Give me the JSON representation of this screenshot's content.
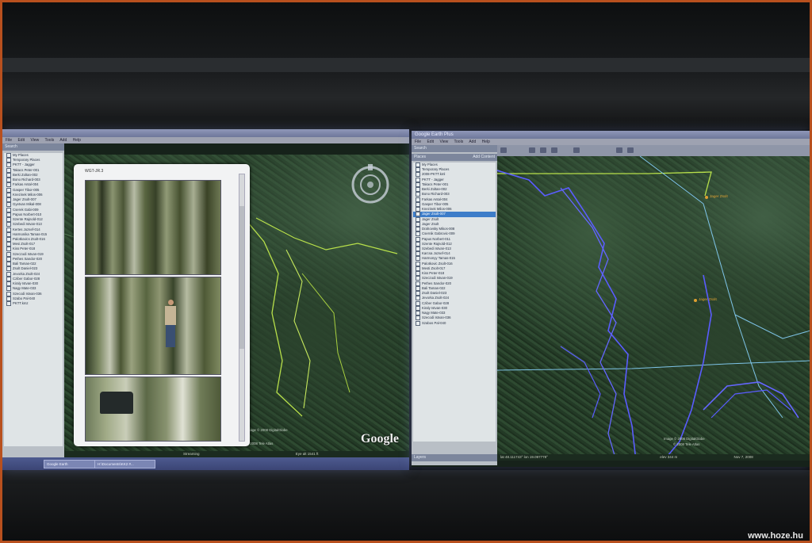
{
  "left_window": {
    "menu": [
      "File",
      "Edit",
      "View",
      "Tools",
      "Add",
      "Help"
    ],
    "search_label": "Search",
    "tree_items": [
      "My Places",
      "Temporary Places",
      "PKTT - Jagger",
      "Takacs Peter-001",
      "Berki Zoltan-002",
      "Bono Richard-003",
      "Farkas Antal-004",
      "Gasper Tibor-005",
      "Knezinek Milos-006",
      "Jager Zsolt-007",
      "Gyetvan Mikal-008",
      "Cserek Gabi-009",
      "Papus Norbert-010",
      "Szente Rajnold-012",
      "Szebedi Istvan-013",
      "Kertes Jozsef-014",
      "Harmonika Tamas-015",
      "Palotkovics Zsolt-016",
      "Mesi Zsolt-017",
      "Kiss Peter-018",
      "Szeczodi Istvan-019",
      "Pethes Sandor-020",
      "Bali Tamas-022",
      "Zsolt Daniel-023",
      "Jevorka Zsolt-024",
      "Cziber Gabor-028",
      "Kiraly Istvan-030",
      "Nagy Mate-033",
      "Szecodi Istvan-036",
      "Szabo Pal-040",
      "PKTT.kmz"
    ],
    "popup_title": "WGT-JR.3",
    "status_left": "Streaming",
    "status_right": "Eye alt  1541 ft",
    "copyright": "Image © 2008 DigitalGlobe",
    "tele_atlas": "© 2008 Tele Atlas",
    "google": "Google",
    "taskbar": [
      "Google Earth",
      "H:\\Documents\\KK2 #..."
    ]
  },
  "right_window": {
    "title": "Google Earth Plus",
    "menu": [
      "File",
      "Edit",
      "View",
      "Tools",
      "Add",
      "Help"
    ],
    "search_label": "Search",
    "places_label": "Places",
    "add_content": "Add Content",
    "tree_items": [
      "My Places",
      "Temporary Places",
      "2008-PKTT.kml",
      "PKTT - Jagger",
      "Takacs Peter-001",
      "Berki Zoltan-002",
      "Bono Richard-003",
      "Farkas Antal-004",
      "Gasper Tibor-005",
      "Knezinek Milos-006",
      "Jager Zsolt-007",
      "Jager Zsolt",
      "Jager Zsolt",
      "Drahovsky Mikos-008",
      "Csernik Gabrovic-009",
      "Papus Norbert-011",
      "Szente Rajnold-012",
      "Szebedi Istvan-013",
      "Karcsa Jozsef-014",
      "Harmonyy Tamas-015",
      "Palotkovic Zsolt-016",
      "Mesti Zsolt-017",
      "Kiss Peter-018",
      "Szeczodi Istvan-019",
      "Pethes Sandor-020",
      "Bali Tamas-022",
      "Zsolt Daniel-023",
      "Jevorka Zsolt-024",
      "Cziber Gabor-028",
      "Kiraly Istvan-030",
      "Nagy Mate-033",
      "Szecodi Istvan-036",
      "Szabos Pal-040"
    ],
    "selected_index": 10,
    "layers_label": "Layers",
    "status_coords": "lat  48.111743°   lon  19.097778°",
    "status_date": "Nov 7, 2008",
    "status_elev": "elev 344 m",
    "copyright": "Image © 2008 DigitalGlobe",
    "tele_atlas": "© 2008 Tele Atlas",
    "labels": [
      "Jager Zsolt",
      "Jager Zsolt"
    ]
  },
  "watermark": "www.hoze.hu",
  "colors": {
    "track_blue": "#5a5cff",
    "track_green": "#b8e04a",
    "track_cyan": "#7ec4e8",
    "label_orange": "#e0a030"
  }
}
